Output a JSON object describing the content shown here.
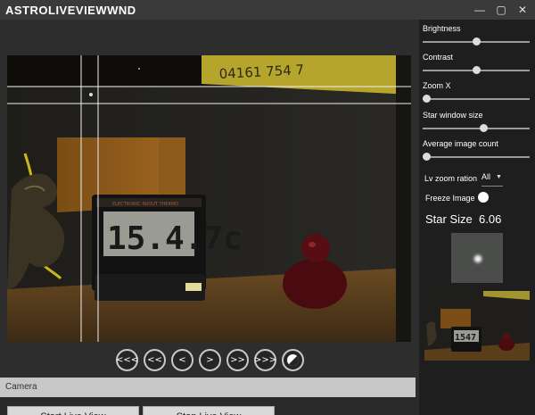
{
  "window": {
    "title": "ASTROLIVEVIEWWND",
    "minimize_glyph": "—",
    "maximize_glyph": "▢",
    "close_glyph": "✕"
  },
  "navigation": {
    "buttons": [
      "<<<",
      "<<",
      "<",
      ">",
      ">>",
      ">>>"
    ]
  },
  "camera": {
    "panel_label": "Camera",
    "start_label": "Start Live View",
    "stop_label": "Stop Live View"
  },
  "controls": {
    "brightness_label": "Brightness",
    "brightness_value": 0.5,
    "contrast_label": "Contrast",
    "contrast_value": 0.5,
    "zoom_x_label": "Zoom X",
    "zoom_x_value": 0.0,
    "star_window_label": "Star window size",
    "star_window_value": 0.58,
    "avg_count_label": "Average image count",
    "avg_count_value": 0.0,
    "lv_zoom_label": "Lv zoom ration",
    "lv_zoom_value": "All",
    "freeze_label": "Freeze Image",
    "freeze_on": false,
    "star_size_label": "Star Size",
    "star_size_value": "6.06"
  },
  "scene": {
    "sticker_text": "04161  754  7",
    "lcd_text": "15.4.7c",
    "device_header": "ELECTRONIC IN/OUT THERMO"
  },
  "thumbnail": {
    "lcd_text": "1547"
  }
}
